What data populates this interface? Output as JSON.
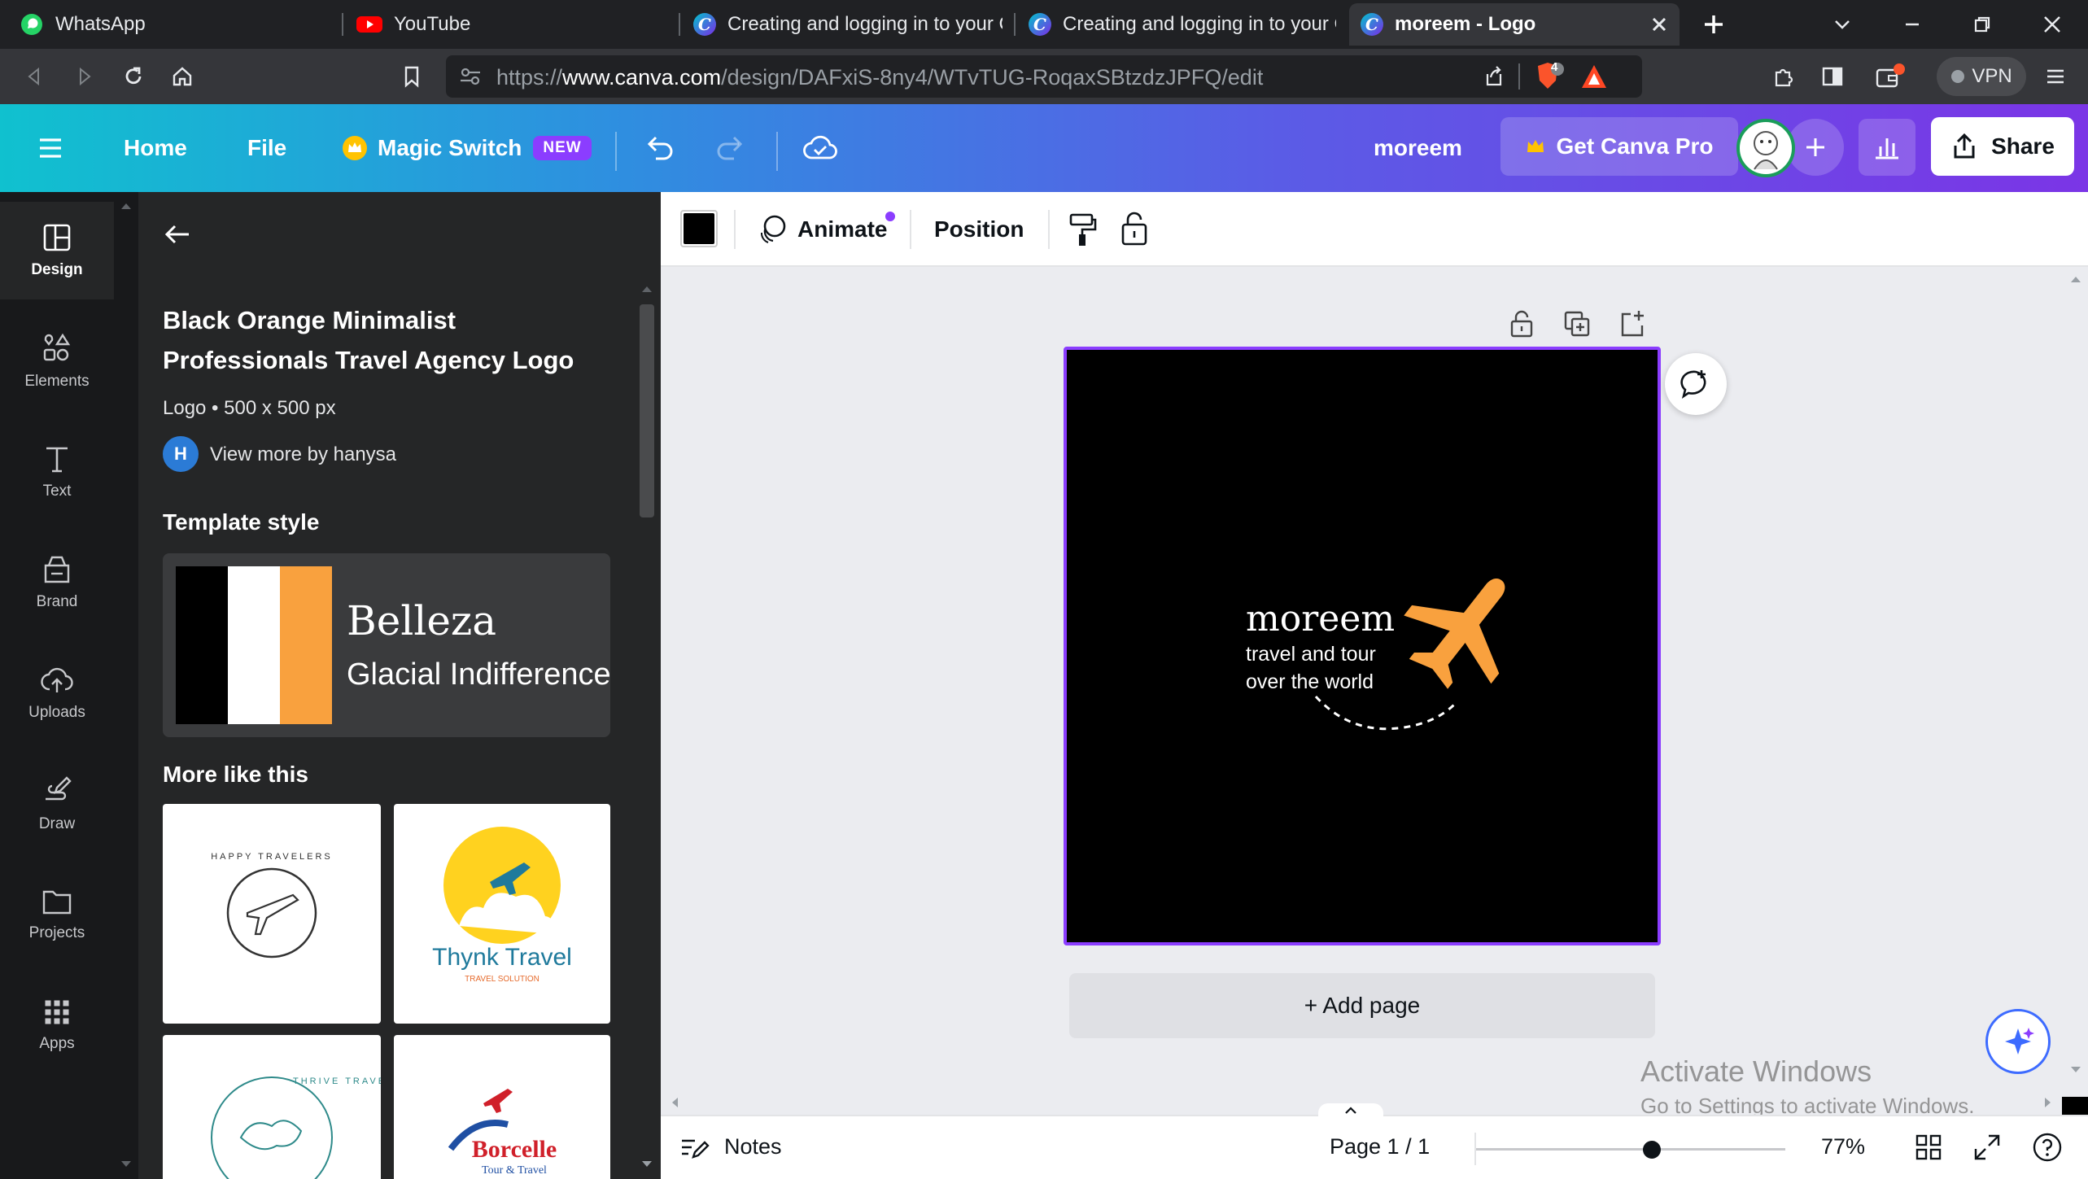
{
  "browser": {
    "tabs": [
      {
        "title": "WhatsApp",
        "icon": "whatsapp-icon"
      },
      {
        "title": "YouTube",
        "icon": "youtube-icon"
      },
      {
        "title": "Creating and logging in to your Ca",
        "icon": "canva-icon"
      },
      {
        "title": "Creating and logging in to your Ca",
        "icon": "canva-icon"
      },
      {
        "title": "moreem - Logo",
        "icon": "canva-icon",
        "active": true
      }
    ],
    "url_prefix": "https://",
    "url_domain": "www.canva.com",
    "url_path": "/design/DAFxiS-8ny4/WTvTUG-RoqaxSBtzdzJPFQ/edit",
    "brave_badge": "4",
    "vpn_label": "VPN"
  },
  "header": {
    "home": "Home",
    "file": "File",
    "magic_switch": "Magic Switch",
    "new_badge": "NEW",
    "design_name": "moreem",
    "get_pro": "Get Canva Pro",
    "share": "Share"
  },
  "rail": {
    "items": [
      {
        "label": "Design",
        "icon": "design-icon"
      },
      {
        "label": "Elements",
        "icon": "elements-icon"
      },
      {
        "label": "Text",
        "icon": "text-icon"
      },
      {
        "label": "Brand",
        "icon": "brand-icon"
      },
      {
        "label": "Uploads",
        "icon": "uploads-icon"
      },
      {
        "label": "Draw",
        "icon": "draw-icon"
      },
      {
        "label": "Projects",
        "icon": "projects-icon"
      },
      {
        "label": "Apps",
        "icon": "apps-icon"
      }
    ]
  },
  "panel": {
    "title_line1": "Black Orange Minimalist",
    "title_line2": "Professionals Travel Agency Logo",
    "meta": "Logo • 500 x 500 px",
    "author_initial": "H",
    "view_more": "View more by hanysa",
    "template_style_heading": "Template style",
    "style_font_primary": "Belleza",
    "style_font_secondary": "Glacial Indifference",
    "style_colors": [
      "#000000",
      "#ffffff",
      "#f9a13e"
    ],
    "more_like_this": "More like this",
    "thumbs": [
      {
        "arc_text": "HAPPY TRAVELERS"
      },
      {
        "name": "Thynk Travel",
        "sub": "TRAVEL SOLUTION"
      },
      {
        "arc_text": "THRIVE TRAVEL"
      },
      {
        "name": "Borcelle",
        "sub": "Tour & Travel"
      }
    ]
  },
  "toolbar": {
    "color_swatch": "#000000",
    "animate": "Animate",
    "position": "Position"
  },
  "canvas": {
    "brand": "moreem",
    "tagline1": "travel and tour",
    "tagline2": "over the world",
    "background": "#000000",
    "plane_color": "#f9a13e",
    "add_page": "+ Add page"
  },
  "footer": {
    "notes": "Notes",
    "page": "Page 1 / 1",
    "zoom": "77%",
    "zoom_fraction": 0.77
  },
  "watermark": {
    "line1": "Activate Windows",
    "line2": "Go to Settings to activate Windows."
  },
  "colors": {
    "accent": "#8b3dff",
    "header_start": "#10c1cf",
    "header_end": "#7b35e6"
  }
}
